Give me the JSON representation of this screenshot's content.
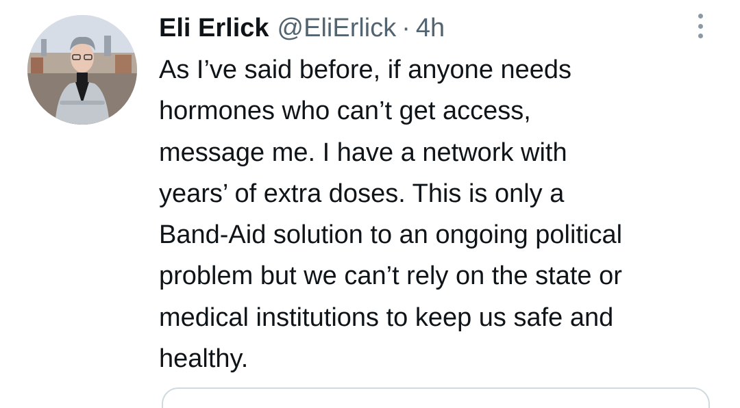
{
  "tweet": {
    "author": {
      "display_name": "Eli Erlick",
      "handle": "@EliErlick",
      "avatar_icon": "profile-photo"
    },
    "separator": "·",
    "timestamp": "4h",
    "more_icon": "vertical-ellipsis-icon",
    "text_lines": [
      "As I’ve said before, if anyone needs",
      "hormones who can’t get access,",
      "message me. I have a network with",
      "years’ of extra doses. This is only a",
      "Band-Aid solution to an ongoing political",
      "problem but we can’t rely on the state or",
      "medical institutions to keep us safe and",
      "healthy."
    ]
  },
  "colors": {
    "primary_text": "#0f1419",
    "secondary_text": "#536471",
    "icon_gray": "#8b98a5",
    "border": "#cfd9de"
  }
}
